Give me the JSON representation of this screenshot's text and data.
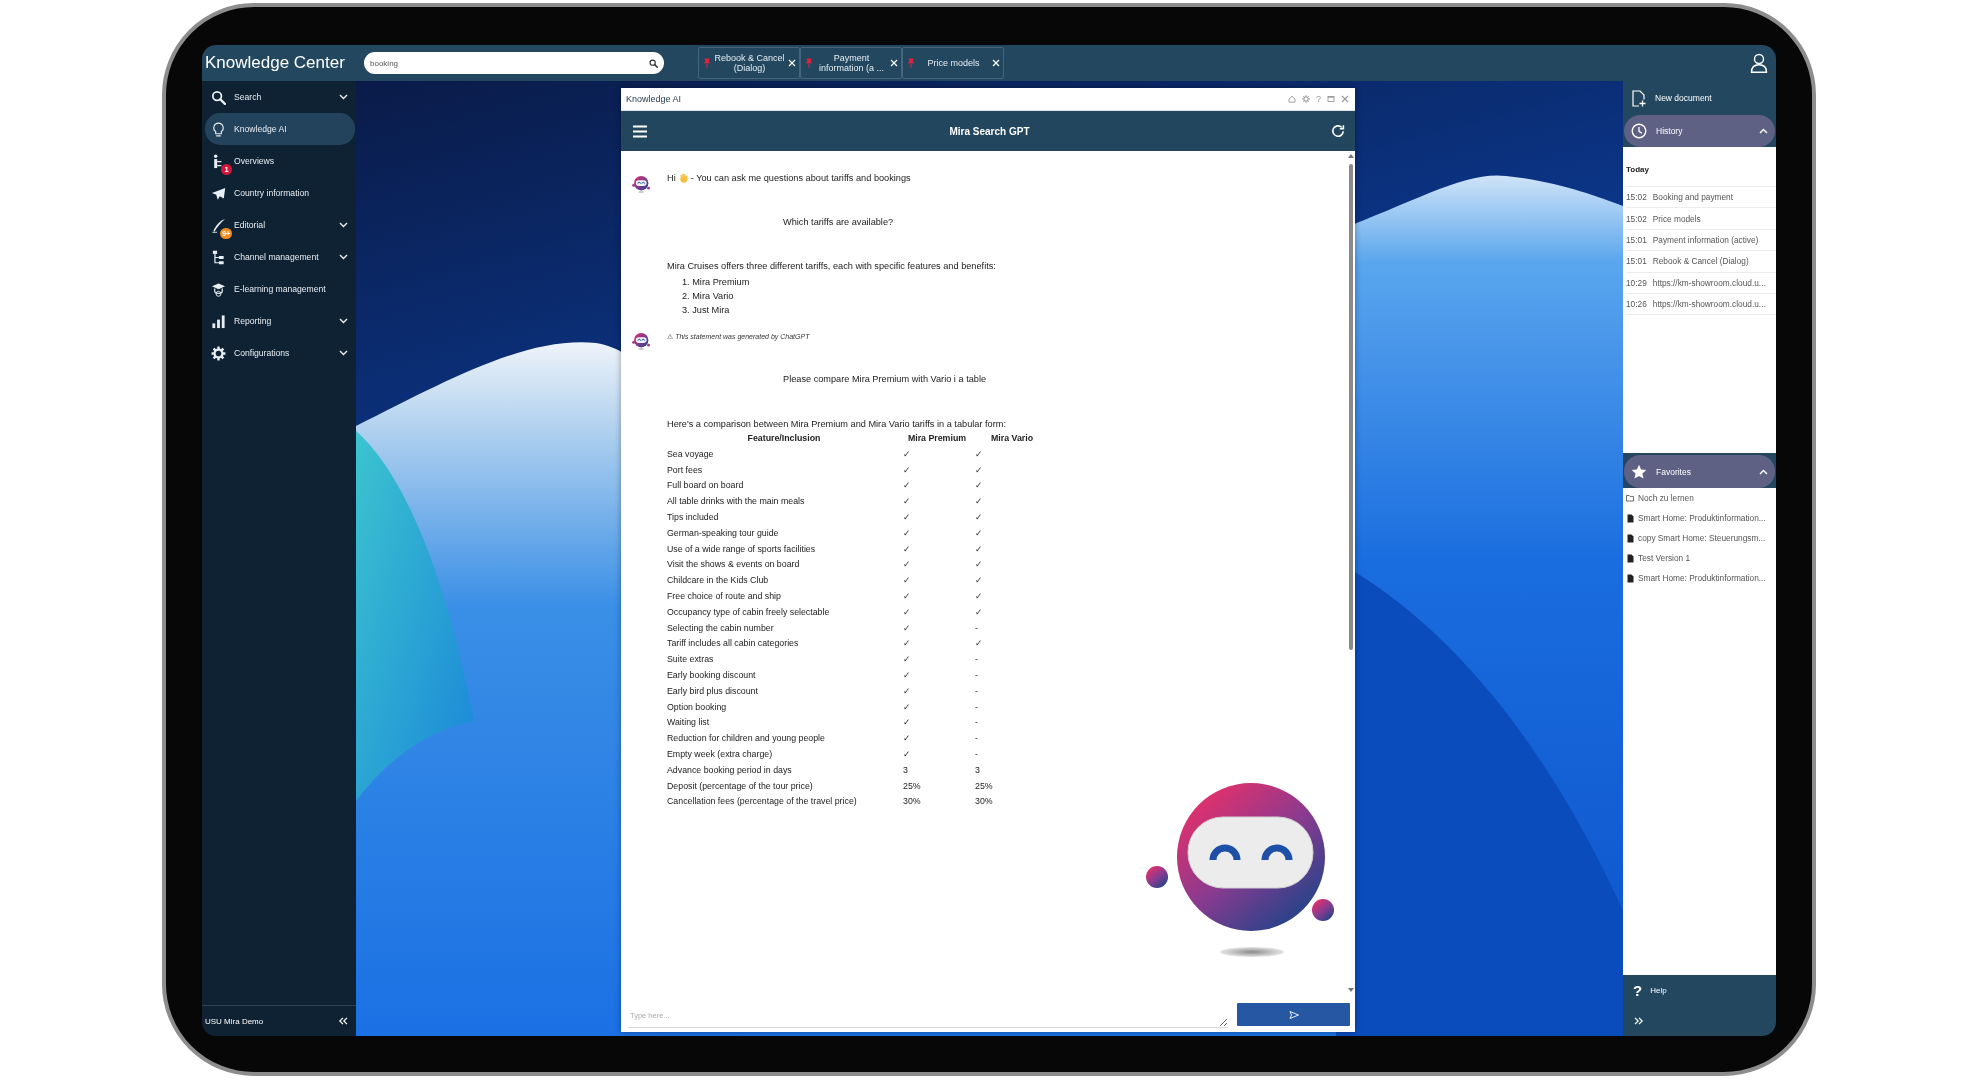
{
  "topbar": {
    "title": "Knowledge Center",
    "search": {
      "value": "booking"
    },
    "tabs": [
      {
        "label": "Rebook & Cancel (Dialog)",
        "pinned": true,
        "selected": false
      },
      {
        "label": "Payment information (a ...",
        "pinned": true,
        "selected": false
      },
      {
        "label": "Price models",
        "pinned": true,
        "selected": false
      }
    ]
  },
  "sidebar": {
    "items": [
      {
        "label": "Search",
        "selected": false,
        "expandable": true
      },
      {
        "label": "Knowledge AI",
        "selected": true,
        "expandable": false
      },
      {
        "label": "Overviews",
        "selected": false,
        "expandable": false,
        "badge": {
          "text": "1",
          "color": "#d3173a"
        }
      },
      {
        "label": "Country information",
        "selected": false,
        "expandable": false
      },
      {
        "label": "Editorial",
        "selected": false,
        "expandable": true,
        "badge": {
          "text": "9+",
          "color": "#f08c1e"
        }
      },
      {
        "label": "Channel management",
        "selected": false,
        "expandable": true
      },
      {
        "label": "E-learning management",
        "selected": false,
        "expandable": false
      },
      {
        "label": "Reporting",
        "selected": false,
        "expandable": true
      },
      {
        "label": "Configurations",
        "selected": false,
        "expandable": true
      }
    ],
    "footer": "USU Mira Demo"
  },
  "chat": {
    "title_bar": {
      "title": "Knowledge AI",
      "help_button": "?"
    },
    "header": "Mira Search GPT",
    "messages": [
      {
        "kind": "greeting",
        "greeting": "Hi",
        "text": "- You can ask me questions about tariffs and bookings"
      },
      {
        "kind": "user",
        "text": "Which tariffs are available?"
      },
      {
        "kind": "answer",
        "text": "Mira Cruises offers three different tariffs, each with specific features and benefits:",
        "list": [
          "1. Mira Premium",
          "2. Mira Vario",
          "3. Just Mira"
        ]
      },
      {
        "kind": "disclaimer",
        "text": "⚠ This statement was generated by ChatGPT"
      },
      {
        "kind": "user",
        "text": "Please compare Mira Premium with Vario i a table"
      },
      {
        "kind": "table_answer",
        "text": "Here's a comparison between Mira Premium and Mira Vario tariffs in a tabular form:",
        "table": {
          "columns": [
            "Feature/Inclusion",
            "Mira Premium",
            "Mira Vario"
          ],
          "rows": [
            [
              "Sea voyage",
              "✓",
              "✓"
            ],
            [
              "Port fees",
              "✓",
              "✓"
            ],
            [
              "Full board on board",
              "✓",
              "✓"
            ],
            [
              "All table drinks with the main meals",
              "✓",
              "✓"
            ],
            [
              "Tips included",
              "✓",
              "✓"
            ],
            [
              "German-speaking tour guide",
              "✓",
              "✓"
            ],
            [
              "Use of a wide range of sports facilities",
              "✓",
              "✓"
            ],
            [
              "Visit the shows & events on board",
              "✓",
              "✓"
            ],
            [
              "Childcare in the Kids Club",
              "✓",
              "✓"
            ],
            [
              "Free choice of route and ship",
              "✓",
              "✓"
            ],
            [
              "Occupancy type of cabin freely selectable",
              "✓",
              "✓"
            ],
            [
              "Selecting the cabin number",
              "✓",
              "-"
            ],
            [
              "Tariff includes all cabin categories",
              "✓",
              "✓"
            ],
            [
              "Suite extras",
              "✓",
              "-"
            ],
            [
              "Early booking discount",
              "✓",
              "-"
            ],
            [
              "Early bird plus discount",
              "✓",
              "-"
            ],
            [
              "Option booking",
              "✓",
              "-"
            ],
            [
              "Waiting list",
              "✓",
              "-"
            ],
            [
              "Reduction for children and young people",
              "✓",
              "-"
            ],
            [
              "Empty week (extra charge)",
              "✓",
              "-"
            ],
            [
              "Advance booking period in days",
              "3",
              "3"
            ],
            [
              "Deposit (percentage of the tour price)",
              "25%",
              "25%"
            ],
            [
              "Cancellation fees (percentage of the travel price)",
              "30%",
              "30%"
            ]
          ]
        }
      }
    ],
    "input": {
      "placeholder": "Type here..."
    }
  },
  "right_panel": {
    "new_document": "New document",
    "history": {
      "title": "History",
      "expanded": true,
      "groups": [
        {
          "label": "Today",
          "entries": [
            {
              "time": "15:02",
              "title": "Booking and payment"
            },
            {
              "time": "15:02",
              "title": "Price models"
            },
            {
              "time": "15:01",
              "title": "Payment information (active)"
            },
            {
              "time": "15:01",
              "title": "Rebook & Cancel (Dialog)"
            },
            {
              "time": "10:29",
              "title": "https://km-showroom.cloud.u..."
            },
            {
              "time": "10:26",
              "title": "https://km-showroom.cloud.u..."
            }
          ]
        }
      ]
    },
    "favorites": {
      "title": "Favorites",
      "expanded": true,
      "items": [
        {
          "kind": "folder",
          "label": "Noch zu lernen"
        },
        {
          "kind": "document",
          "label": "Smart Home: Produktinformation..."
        },
        {
          "kind": "document",
          "label": "copy Smart Home: Steuerungsm..."
        },
        {
          "kind": "document",
          "label": "Test Version 1"
        },
        {
          "kind": "document",
          "label": "Smart Home: Produktinformation..."
        }
      ]
    },
    "help": {
      "glyph": "?",
      "label": "Help"
    }
  }
}
